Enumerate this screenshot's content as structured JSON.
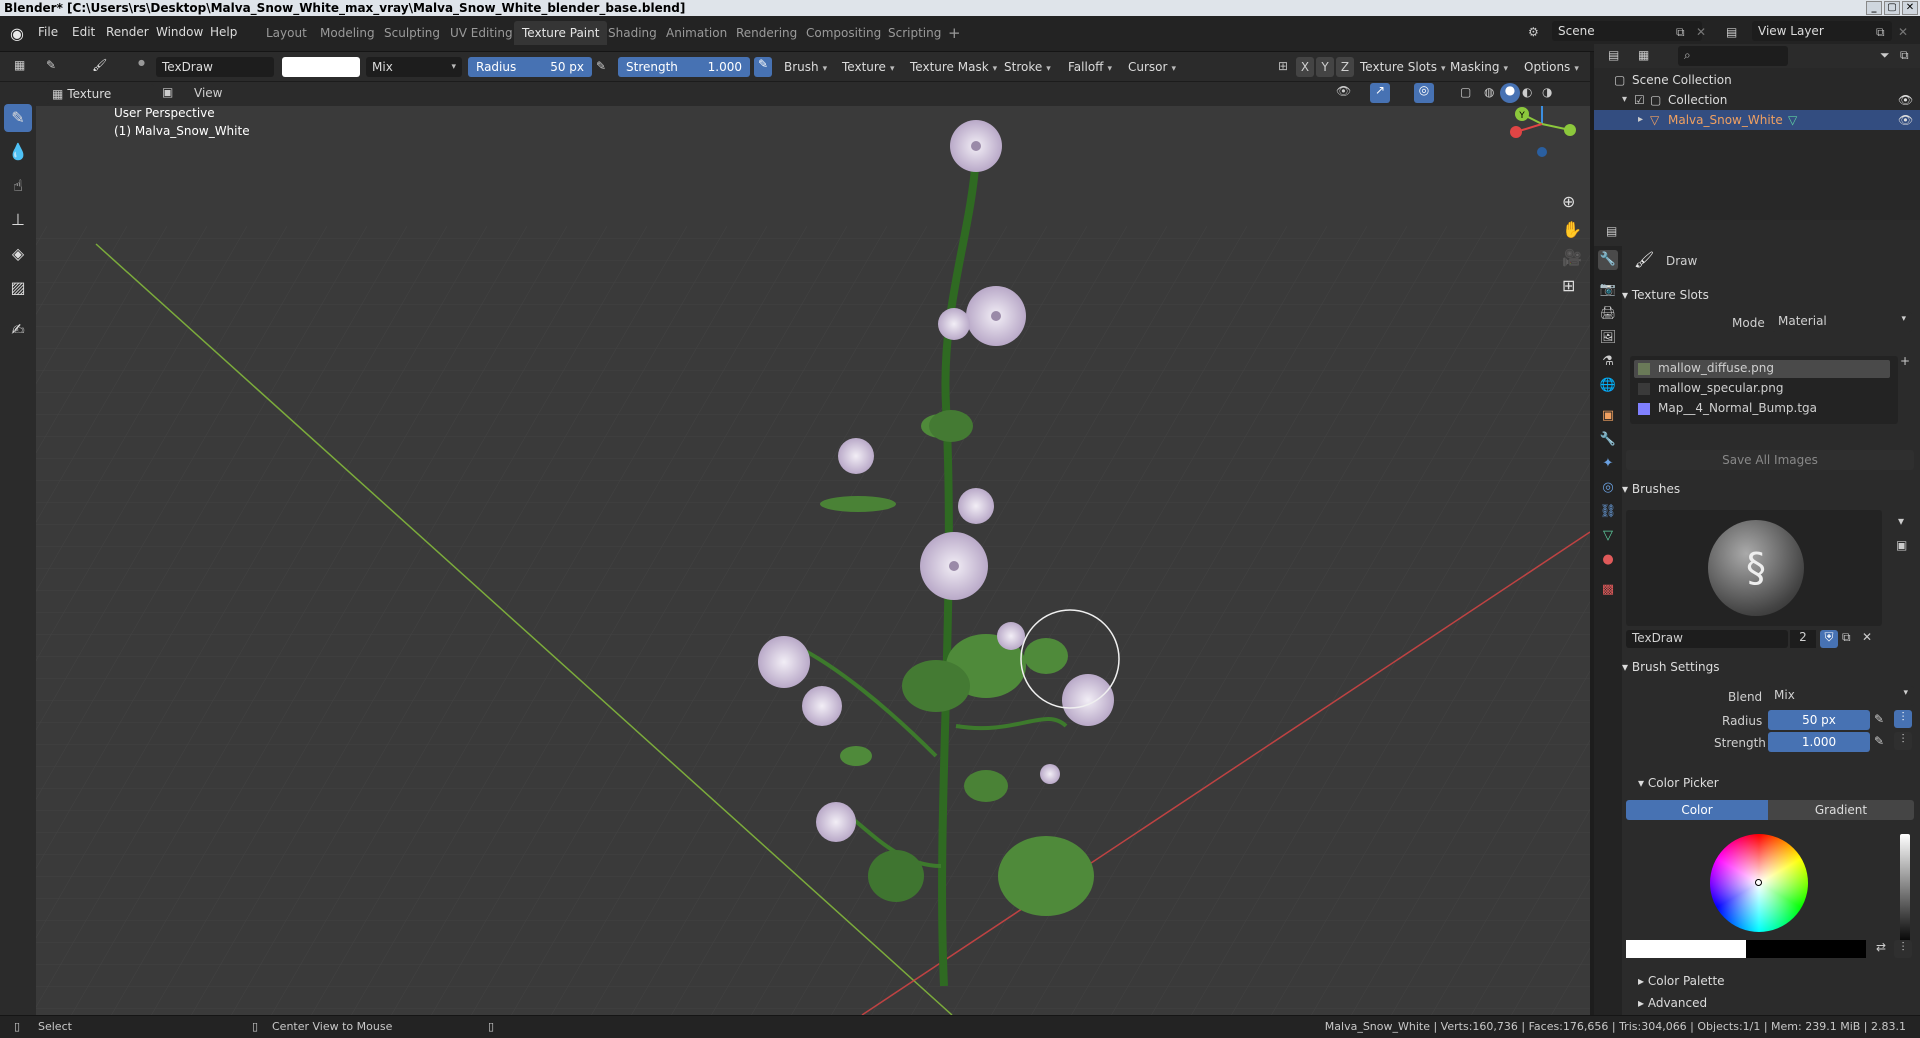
{
  "window": {
    "title": "Blender* [C:\\Users\\rs\\Desktop\\Malva_Snow_White_max_vray\\Malva_Snow_White_blender_base.blend]"
  },
  "topbar": {
    "menus": [
      "File",
      "Edit",
      "Render",
      "Window",
      "Help"
    ],
    "workspaces": [
      "Layout",
      "Modeling",
      "Sculpting",
      "UV Editing",
      "Texture Paint",
      "Shading",
      "Animation",
      "Rendering",
      "Compositing",
      "Scripting"
    ],
    "active_workspace": "Texture Paint",
    "add_tab": "+",
    "scene": "Scene",
    "view_layer": "View Layer"
  },
  "tool_header": {
    "brush_name": "TexDraw",
    "blend_mode": "Mix",
    "radius_label": "Radius",
    "radius_value": "50 px",
    "strength_label": "Strength",
    "strength_value": "1.000",
    "menus": [
      "Brush",
      "Texture",
      "Texture Mask",
      "Stroke",
      "Falloff",
      "Cursor"
    ],
    "axes": [
      "X",
      "Y",
      "Z"
    ],
    "right_menus": [
      "Texture Slots",
      "Masking",
      "Options"
    ]
  },
  "view_header": {
    "mode": "Texture Paint",
    "view_menu": "View"
  },
  "viewport": {
    "perspective_label": "User Perspective",
    "object_label": "(1) Malva_Snow_White",
    "gizmo_axes": [
      "X",
      "Y",
      "Z"
    ]
  },
  "outliner": {
    "search_placeholder": "",
    "rows": [
      {
        "label": "Scene Collection"
      },
      {
        "label": "Collection"
      },
      {
        "label": "Malva_Snow_White"
      }
    ]
  },
  "properties": {
    "tool_name": "Draw",
    "texture_slots": {
      "header": "Texture Slots",
      "mode_label": "Mode",
      "mode_value": "Material",
      "slots": [
        {
          "name": "mallow_diffuse.png",
          "color": "#6a7a58"
        },
        {
          "name": "mallow_specular.png",
          "color": "#3a3a3a"
        },
        {
          "name": "Map__4_Normal_Bump.tga",
          "color": "#8080ff"
        }
      ],
      "save_all": "Save All Images"
    },
    "brushes": {
      "header": "Brushes",
      "brush_name": "TexDraw",
      "users": "2"
    },
    "brush_settings": {
      "header": "Brush Settings",
      "blend_label": "Blend",
      "blend_value": "Mix",
      "radius_label": "Radius",
      "radius_value": "50 px",
      "strength_label": "Strength",
      "strength_value": "1.000"
    },
    "color_picker": {
      "header": "Color Picker",
      "tab_color": "Color",
      "tab_gradient": "Gradient"
    },
    "color_palette": "Color Palette",
    "advanced": "Advanced"
  },
  "statusbar": {
    "select": "Select",
    "center_view": "Center View to Mouse",
    "stats": "Malva_Snow_White | Verts:160,736 | Faces:176,656 | Tris:304,066 | Objects:1/1 | Mem: 239.1 MiB | 2.83.1"
  },
  "colors": {
    "accent": "#4772b3",
    "selection": "#334d80",
    "x_axis": "#e04545",
    "y_axis": "#8cc83c",
    "z_axis": "#3b8ee0",
    "leaf_green": "#4f8a3a",
    "petal": "#d8d0e0"
  }
}
